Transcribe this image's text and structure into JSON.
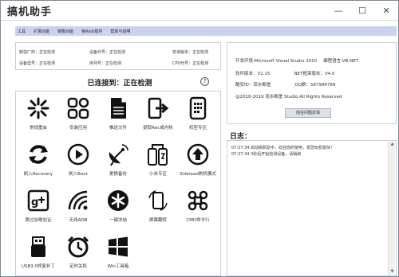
{
  "window": {
    "title": "搞机助手",
    "min": "—",
    "max": "☐",
    "close": "✕"
  },
  "menu": [
    "工具",
    "扩展功能",
    "镜像功能",
    "免Root插件",
    "帮助与说明"
  ],
  "device_info": [
    [
      "制造厂商：正在检测",
      "设备代号：正在检测",
      "安卓版本：正在检测"
    ],
    [
      "设备型号：正在检测",
      "序列号：正在检测",
      "CPU代号：正在检测"
    ]
  ],
  "connection": {
    "status": "已连接到：正在检测",
    "help": "?"
  },
  "tools": [
    {
      "label": "常规重启",
      "icon": "restart-icon"
    },
    {
      "label": "安装应用",
      "icon": "apps-icon"
    },
    {
      "label": "推送文件",
      "icon": "file-icon"
    },
    {
      "label": "提取Rec或内核",
      "icon": "extract-icon"
    },
    {
      "label": "机型专区",
      "icon": "phone-icon"
    },
    {
      "label": "刷入Recovery",
      "icon": "recovery-icon"
    },
    {
      "label": "刷入Boot",
      "icon": "boot-icon"
    },
    {
      "label": "更换备份",
      "icon": "satellite-icon"
    },
    {
      "label": "小米专区",
      "icon": "xiaomi-icon"
    },
    {
      "label": "Sideload刷机模式",
      "icon": "sideload-icon"
    },
    {
      "label": "跳过谷歌验证",
      "icon": "google-plus-icon"
    },
    {
      "label": "无线ADB",
      "icon": "wifi-icon"
    },
    {
      "label": "一键冻结",
      "icon": "freeze-icon"
    },
    {
      "label": "屏幕翻转",
      "icon": "rotate-icon"
    },
    {
      "label": "CMD命令行",
      "icon": "command-icon"
    },
    {
      "label": "USB3.0修复补丁",
      "icon": "usb-icon"
    },
    {
      "label": "定时关机",
      "icon": "alarm-icon"
    },
    {
      "label": "Win工具箱",
      "icon": "windows-icon"
    }
  ],
  "about": {
    "line1a": "开发环境:Microsoft Visual Studio 2010",
    "line1b": "编程语言:VB.NET",
    "line2a": "软件版本：V2.15",
    "line2b": "NET框架版本：V4.0",
    "line3a": "酷安ID：流水断崖",
    "line3b": "QQ群：587994789",
    "line4": "@2018-2019 流水断崖 Studio.All Rights Reserved",
    "feedback_button": "前往问题反馈"
  },
  "log": {
    "title": "日志：",
    "lines": [
      "07:37:34 启动搞机助手，欢迎您的使用，祝您玩机愉快！",
      "07:37:34 3秒后开始检测设备，请稍候"
    ]
  }
}
